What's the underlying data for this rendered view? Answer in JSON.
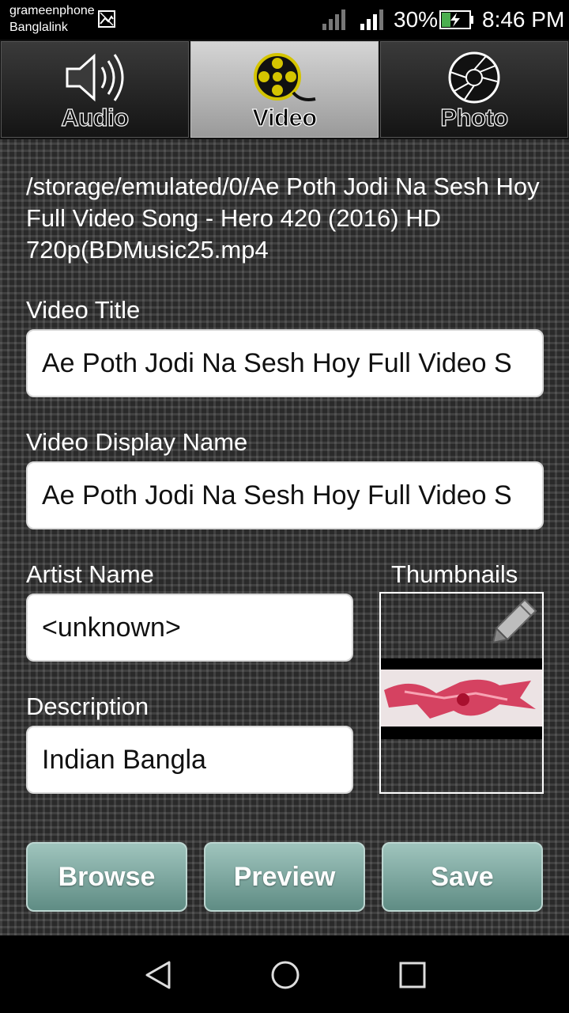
{
  "status_bar": {
    "carrier_1": "grameenphone",
    "carrier_2": "Banglalink",
    "battery_percent": "30%",
    "time": "8:46 PM"
  },
  "tabs": [
    {
      "label": "Audio",
      "icon": "speaker-icon",
      "active": false
    },
    {
      "label": "Video",
      "icon": "film-reel-icon",
      "active": true
    },
    {
      "label": "Photo",
      "icon": "camera-aperture-icon",
      "active": false
    }
  ],
  "file_path": "/storage/emulated/0/Ae Poth Jodi Na Sesh Hoy Full Video Song - Hero 420 (2016) HD 720p(BDMusic25.mp4",
  "form": {
    "video_title_label": "Video Title",
    "video_title_value": "Ae Poth Jodi Na Sesh Hoy Full Video S",
    "display_name_label": "Video Display Name",
    "display_name_value": "Ae Poth Jodi Na Sesh Hoy Full Video S",
    "artist_label": "Artist Name",
    "artist_value": "<unknown>",
    "description_label": "Description",
    "description_value": "Indian Bangla",
    "thumbnails_label": "Thumbnails"
  },
  "buttons": {
    "browse": "Browse",
    "preview": "Preview",
    "save": "Save"
  },
  "colors": {
    "button_top": "#9fc4bd",
    "button_bottom": "#5f8c84",
    "active_tab": "#c0c0c0"
  }
}
